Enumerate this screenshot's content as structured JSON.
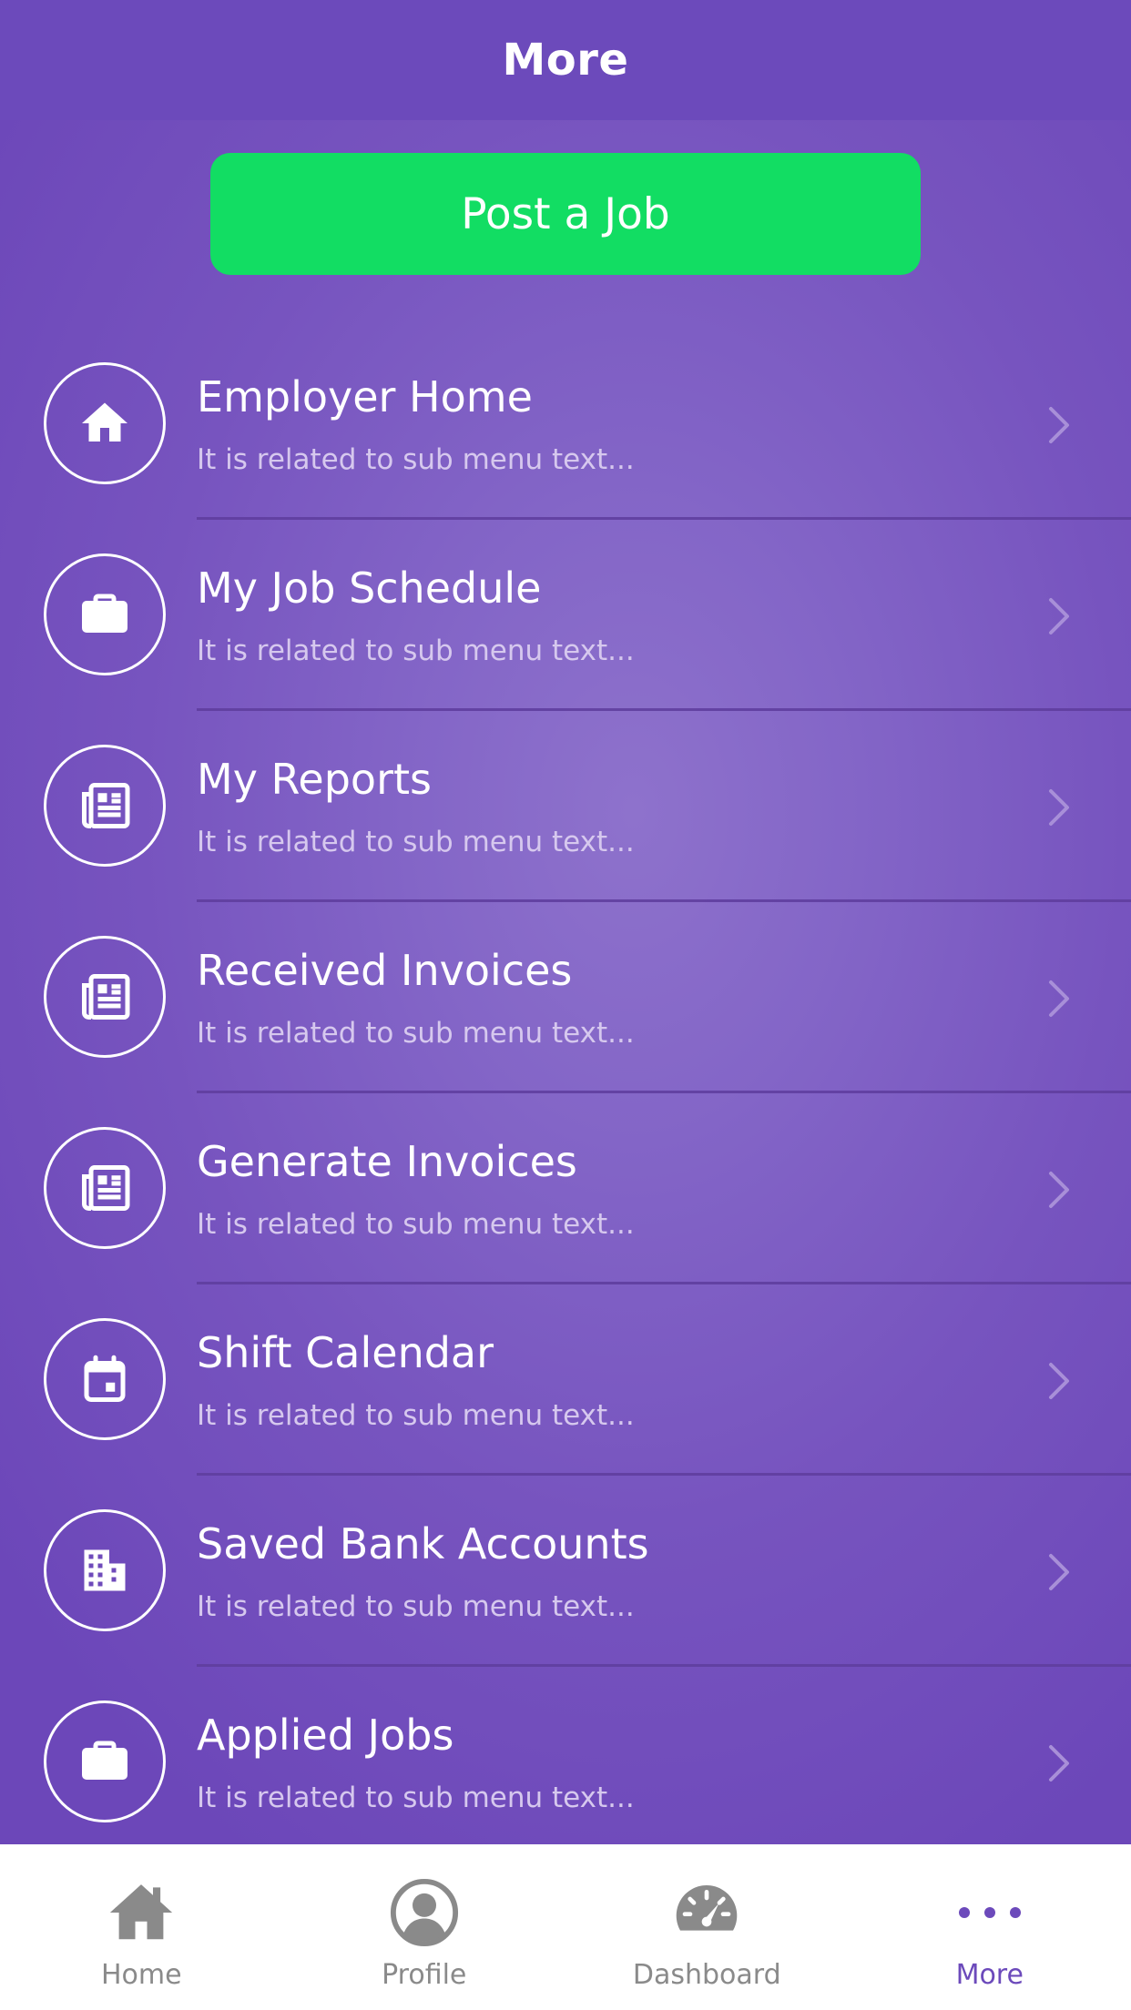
{
  "header": {
    "title": "More"
  },
  "post_job": {
    "label": "Post a Job"
  },
  "menu": {
    "items": [
      {
        "title": "Employer Home",
        "subtitle": "It is related to sub menu text...",
        "icon": "home-icon"
      },
      {
        "title": "My Job Schedule",
        "subtitle": "It is related to sub menu text...",
        "icon": "briefcase-icon"
      },
      {
        "title": "My Reports",
        "subtitle": "It is related to sub menu text...",
        "icon": "newspaper-icon"
      },
      {
        "title": "Received Invoices",
        "subtitle": "It is related to sub menu text...",
        "icon": "newspaper-icon"
      },
      {
        "title": "Generate Invoices",
        "subtitle": "It is related to sub menu text...",
        "icon": "newspaper-icon"
      },
      {
        "title": "Shift Calendar",
        "subtitle": "It is related to sub menu text...",
        "icon": "calendar-icon"
      },
      {
        "title": "Saved Bank Accounts",
        "subtitle": "It is related to sub menu text...",
        "icon": "building-icon"
      },
      {
        "title": "Applied Jobs",
        "subtitle": "It is related to sub menu text...",
        "icon": "briefcase-icon"
      }
    ]
  },
  "tabbar": {
    "tabs": [
      {
        "label": "Home",
        "icon": "home-icon",
        "active": false
      },
      {
        "label": "Profile",
        "icon": "user-circle-icon",
        "active": false
      },
      {
        "label": "Dashboard",
        "icon": "speedometer-icon",
        "active": false
      },
      {
        "label": "More",
        "icon": "more-dots-icon",
        "active": true
      }
    ]
  },
  "colors": {
    "header_bg": "#6c4abb",
    "background_center": "#8e72cc",
    "background_edge": "#6c47b9",
    "post_button": "#12dd63",
    "tab_active": "#6c4abb",
    "tab_inactive": "#8a8a8a",
    "subtitle_text": "#d6c8ee"
  }
}
